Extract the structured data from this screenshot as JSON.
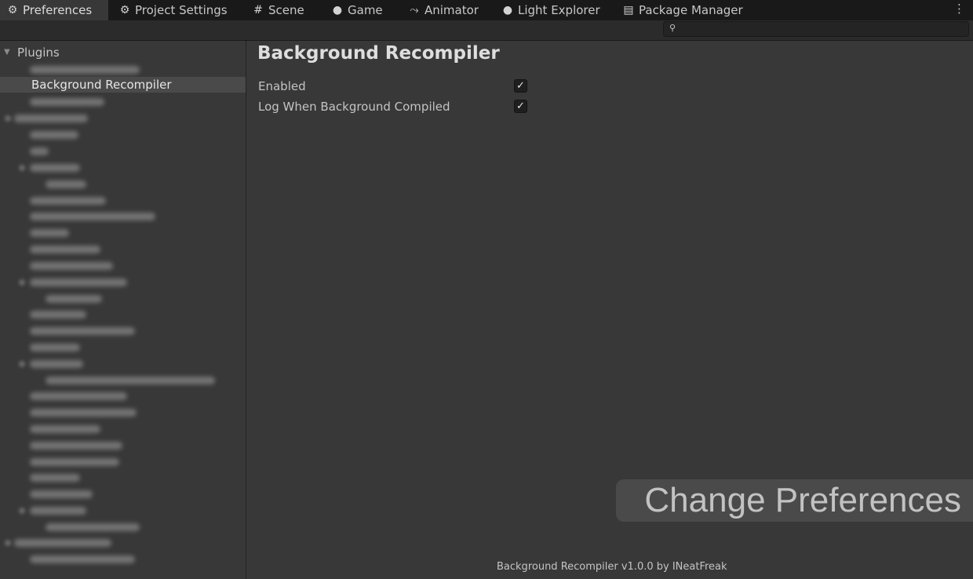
{
  "tabs": [
    {
      "label": "Preferences",
      "icon": "gear-icon",
      "glyph": "⚙"
    },
    {
      "label": "Project Settings",
      "icon": "gear-icon",
      "glyph": "⚙"
    },
    {
      "label": "Scene",
      "icon": "hash-icon",
      "glyph": "#"
    },
    {
      "label": "Game",
      "icon": "gamepad-icon",
      "glyph": "●"
    },
    {
      "label": "Animator",
      "icon": "animator-icon",
      "glyph": "⤳"
    },
    {
      "label": "Light Explorer",
      "icon": "lightbulb-icon",
      "glyph": "●"
    },
    {
      "label": "Package Manager",
      "icon": "package-icon",
      "glyph": "▤"
    }
  ],
  "menu_glyph": "⋮",
  "search": {
    "icon": "search-icon",
    "glyph": "🔍",
    "placeholder": ""
  },
  "sidebar": {
    "root": {
      "label": "Plugins",
      "arrow": "▼"
    },
    "selected": {
      "label": "Background Recompiler"
    }
  },
  "page": {
    "title": "Background Recompiler",
    "settings": [
      {
        "label": "Enabled",
        "checked": true,
        "glyph": "✓"
      },
      {
        "label": "Log When Background Compiled",
        "checked": true,
        "glyph": "✓"
      }
    ]
  },
  "overlay": {
    "text": "Change Preferences"
  },
  "footer": {
    "text": "Background Recompiler v1.0.0 by INeatFreak"
  },
  "colors": {
    "background": "#383838",
    "tabbar": "#191919",
    "selected_row": "#4a4a4a",
    "text": "#c4c4c4"
  }
}
